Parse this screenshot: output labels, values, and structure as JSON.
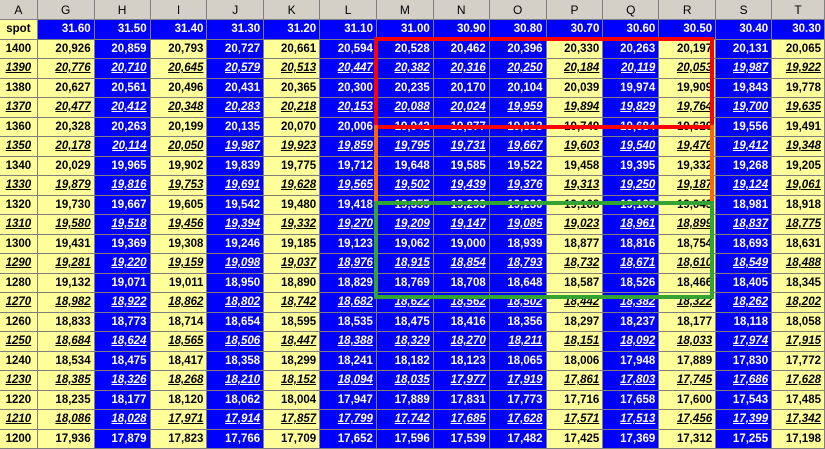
{
  "columns": [
    "A",
    "G",
    "H",
    "I",
    "J",
    "K",
    "L",
    "M",
    "N",
    "O",
    "P",
    "Q",
    "R",
    "S",
    "T"
  ],
  "spot_label": "spot",
  "spot_values": [
    "31.60",
    "31.50",
    "31.40",
    "31.30",
    "31.20",
    "31.10",
    "31.00",
    "30.90",
    "30.80",
    "30.70",
    "30.60",
    "30.50",
    "30.40",
    "30.30"
  ],
  "rows": [
    {
      "label": "1400",
      "alt": false,
      "values": [
        "20,926",
        "20,859",
        "20,793",
        "20,727",
        "20,661",
        "20,594",
        "20,528",
        "20,462",
        "20,396",
        "20,330",
        "20,263",
        "20,197",
        "20,131",
        "20,065"
      ]
    },
    {
      "label": "1390",
      "alt": true,
      "values": [
        "20,776",
        "20,710",
        "20,645",
        "20,579",
        "20,513",
        "20,447",
        "20,382",
        "20,316",
        "20,250",
        "20,184",
        "20,119",
        "20,053",
        "19,987",
        "19,922"
      ]
    },
    {
      "label": "1380",
      "alt": false,
      "values": [
        "20,627",
        "20,561",
        "20,496",
        "20,431",
        "20,365",
        "20,300",
        "20,235",
        "20,170",
        "20,104",
        "20,039",
        "19,974",
        "19,909",
        "19,843",
        "19,778"
      ]
    },
    {
      "label": "1370",
      "alt": true,
      "values": [
        "20,477",
        "20,412",
        "20,348",
        "20,283",
        "20,218",
        "20,153",
        "20,088",
        "20,024",
        "19,959",
        "19,894",
        "19,829",
        "19,764",
        "19,700",
        "19,635"
      ]
    },
    {
      "label": "1360",
      "alt": false,
      "values": [
        "20,328",
        "20,263",
        "20,199",
        "20,135",
        "20,070",
        "20,006",
        "19,942",
        "19,877",
        "19,813",
        "19,749",
        "19,684",
        "19,620",
        "19,556",
        "19,491"
      ]
    },
    {
      "label": "1350",
      "alt": true,
      "values": [
        "20,178",
        "20,114",
        "20,050",
        "19,987",
        "19,923",
        "19,859",
        "19,795",
        "19,731",
        "19,667",
        "19,603",
        "19,540",
        "19,476",
        "19,412",
        "19,348"
      ]
    },
    {
      "label": "1340",
      "alt": false,
      "values": [
        "20,029",
        "19,965",
        "19,902",
        "19,839",
        "19,775",
        "19,712",
        "19,648",
        "19,585",
        "19,522",
        "19,458",
        "19,395",
        "19,332",
        "19,268",
        "19,205"
      ]
    },
    {
      "label": "1330",
      "alt": true,
      "values": [
        "19,879",
        "19,816",
        "19,753",
        "19,691",
        "19,628",
        "19,565",
        "19,502",
        "19,439",
        "19,376",
        "19,313",
        "19,250",
        "19,187",
        "19,124",
        "19,061"
      ]
    },
    {
      "label": "1320",
      "alt": false,
      "values": [
        "19,730",
        "19,667",
        "19,605",
        "19,542",
        "19,480",
        "19,418",
        "19,355",
        "19,293",
        "19,230",
        "19,168",
        "19,105",
        "19,043",
        "18,981",
        "18,918"
      ]
    },
    {
      "label": "1310",
      "alt": true,
      "values": [
        "19,580",
        "19,518",
        "19,456",
        "19,394",
        "19,332",
        "19,270",
        "19,209",
        "19,147",
        "19,085",
        "19,023",
        "18,961",
        "18,899",
        "18,837",
        "18,775"
      ]
    },
    {
      "label": "1300",
      "alt": false,
      "values": [
        "19,431",
        "19,369",
        "19,308",
        "19,246",
        "19,185",
        "19,123",
        "19,062",
        "19,000",
        "18,939",
        "18,877",
        "18,816",
        "18,754",
        "18,693",
        "18,631"
      ]
    },
    {
      "label": "1290",
      "alt": true,
      "values": [
        "19,281",
        "19,220",
        "19,159",
        "19,098",
        "19,037",
        "18,976",
        "18,915",
        "18,854",
        "18,793",
        "18,732",
        "18,671",
        "18,610",
        "18,549",
        "18,488"
      ]
    },
    {
      "label": "1280",
      "alt": false,
      "values": [
        "19,132",
        "19,071",
        "19,011",
        "18,950",
        "18,890",
        "18,829",
        "18,769",
        "18,708",
        "18,648",
        "18,587",
        "18,526",
        "18,466",
        "18,405",
        "18,345"
      ]
    },
    {
      "label": "1270",
      "alt": true,
      "values": [
        "18,982",
        "18,922",
        "18,862",
        "18,802",
        "18,742",
        "18,682",
        "18,622",
        "18,562",
        "18,502",
        "18,442",
        "18,382",
        "18,322",
        "18,262",
        "18,202"
      ]
    },
    {
      "label": "1260",
      "alt": false,
      "values": [
        "18,833",
        "18,773",
        "18,714",
        "18,654",
        "18,595",
        "18,535",
        "18,475",
        "18,416",
        "18,356",
        "18,297",
        "18,237",
        "18,177",
        "18,118",
        "18,058"
      ]
    },
    {
      "label": "1250",
      "alt": true,
      "values": [
        "18,684",
        "18,624",
        "18,565",
        "18,506",
        "18,447",
        "18,388",
        "18,329",
        "18,270",
        "18,211",
        "18,151",
        "18,092",
        "18,033",
        "17,974",
        "17,915"
      ]
    },
    {
      "label": "1240",
      "alt": false,
      "values": [
        "18,534",
        "18,475",
        "18,417",
        "18,358",
        "18,299",
        "18,241",
        "18,182",
        "18,123",
        "18,065",
        "18,006",
        "17,948",
        "17,889",
        "17,830",
        "17,772"
      ]
    },
    {
      "label": "1230",
      "alt": true,
      "values": [
        "18,385",
        "18,326",
        "18,268",
        "18,210",
        "18,152",
        "18,094",
        "18,035",
        "17,977",
        "17,919",
        "17,861",
        "17,803",
        "17,745",
        "17,686",
        "17,628"
      ]
    },
    {
      "label": "1220",
      "alt": false,
      "values": [
        "18,235",
        "18,177",
        "18,120",
        "18,062",
        "18,004",
        "17,947",
        "17,889",
        "17,831",
        "17,773",
        "17,716",
        "17,658",
        "17,600",
        "17,543",
        "17,485"
      ]
    },
    {
      "label": "1210",
      "alt": true,
      "values": [
        "18,086",
        "18,028",
        "17,971",
        "17,914",
        "17,857",
        "17,799",
        "17,742",
        "17,685",
        "17,628",
        "17,571",
        "17,513",
        "17,456",
        "17,399",
        "17,342"
      ]
    },
    {
      "label": "1200",
      "alt": false,
      "values": [
        "17,936",
        "17,879",
        "17,823",
        "17,766",
        "17,709",
        "17,652",
        "17,596",
        "17,539",
        "17,482",
        "17,425",
        "17,369",
        "17,312",
        "17,255",
        "17,198"
      ]
    }
  ],
  "colors": {
    "cell_yellow": "#ffff99",
    "cell_blue": "#0000ff",
    "header_grey": "#d4d0c8",
    "highlight_red": "#ff0000",
    "highlight_orange": "#ff6600",
    "highlight_green": "#33a333"
  }
}
